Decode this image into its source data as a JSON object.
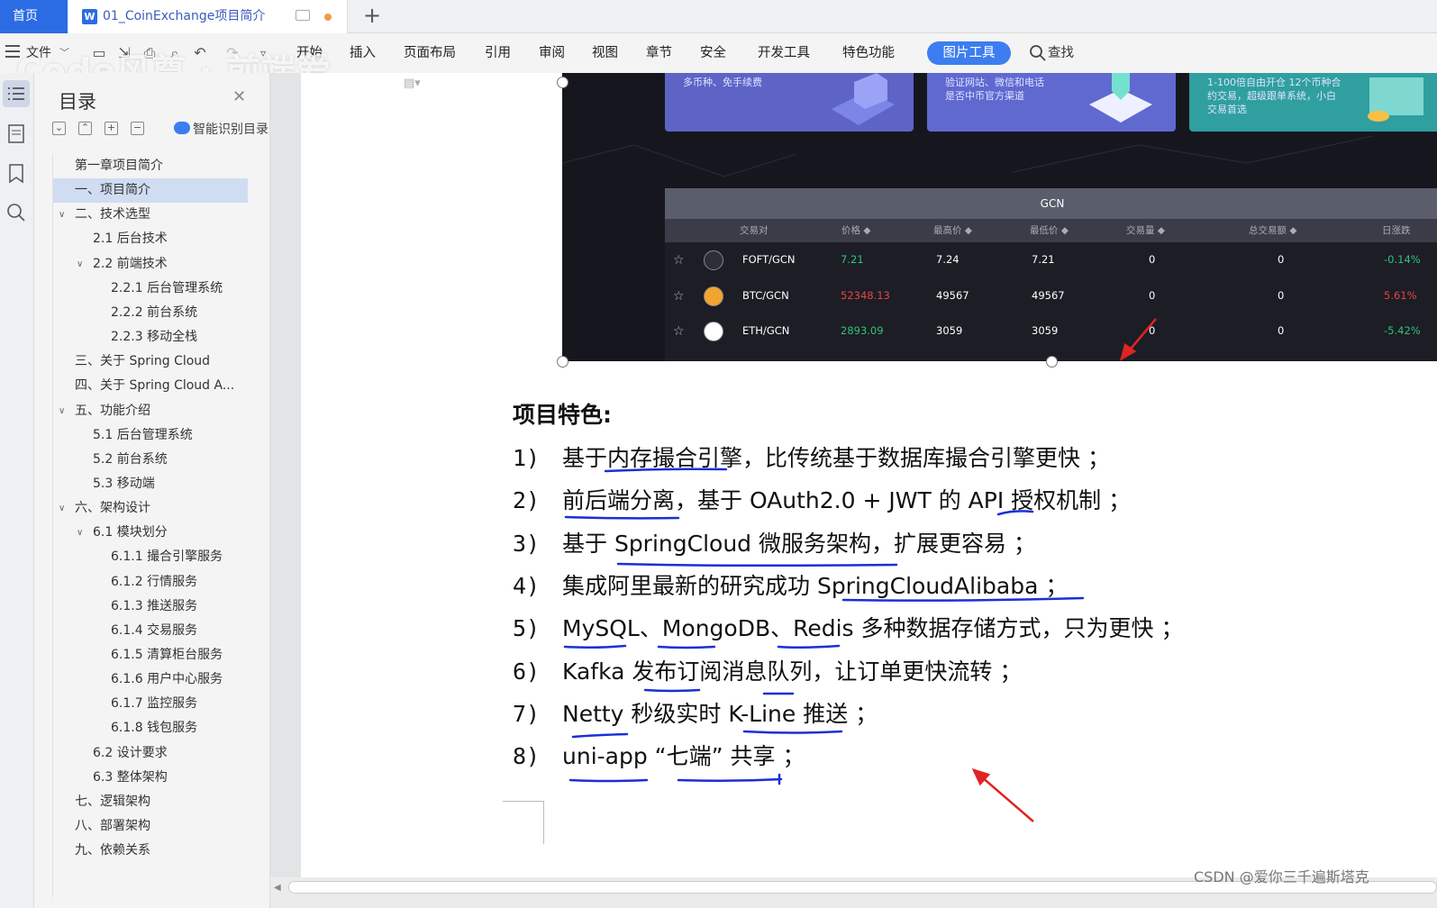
{
  "tabs": {
    "home": "首页",
    "doc_title": "01_CoinExchange项目简介"
  },
  "ribbon": {
    "file": "文件",
    "tabs": [
      "开始",
      "插入",
      "页面布局",
      "引用",
      "审阅",
      "视图",
      "章节",
      "安全",
      "开发工具",
      "特色功能"
    ],
    "active_tab": "图片工具",
    "search": "查找"
  },
  "watermark": "Code风尊 · 前端爱",
  "nav": {
    "title": "目录",
    "smart": "智能识别目录",
    "items": [
      {
        "label": "第一章项目简介",
        "level": 0
      },
      {
        "label": "一、项目简介",
        "level": 0,
        "selected": true
      },
      {
        "label": "二、技术选型",
        "level": 0,
        "expand": true
      },
      {
        "label": "2.1  后台技术",
        "level": 1
      },
      {
        "label": "2.2  前端技术",
        "level": 1,
        "expand": true
      },
      {
        "label": "2.2.1  后台管理系统",
        "level": 2
      },
      {
        "label": "2.2.2  前台系统",
        "level": 2
      },
      {
        "label": "2.2.3  移动全栈",
        "level": 2
      },
      {
        "label": "三、关于 Spring Cloud",
        "level": 0
      },
      {
        "label": "四、关于 Spring Cloud A...",
        "level": 0
      },
      {
        "label": "五、功能介绍",
        "level": 0,
        "expand": true
      },
      {
        "label": "5.1  后台管理系统",
        "level": 1
      },
      {
        "label": "5.2  前台系统",
        "level": 1
      },
      {
        "label": "5.3  移动端",
        "level": 1
      },
      {
        "label": "六、架构设计",
        "level": 0,
        "expand": true
      },
      {
        "label": "6.1  模块划分",
        "level": 1,
        "expand": true
      },
      {
        "label": "6.1.1  撮合引擎服务",
        "level": 2
      },
      {
        "label": "6.1.2  行情服务",
        "level": 2
      },
      {
        "label": "6.1.3  推送服务",
        "level": 2
      },
      {
        "label": "6.1.4  交易服务",
        "level": 2
      },
      {
        "label": "6.1.5  清算柜台服务",
        "level": 2
      },
      {
        "label": "6.1.6  用户中心服务",
        "level": 2
      },
      {
        "label": "6.1.7  监控服务",
        "level": 2
      },
      {
        "label": "6.1.8  钱包服务",
        "level": 2
      },
      {
        "label": "6.2  设计要求",
        "level": 1
      },
      {
        "label": "6.3  整体架构",
        "level": 1
      },
      {
        "label": "七、逻辑架构",
        "level": 0
      },
      {
        "label": "八、部署架构",
        "level": 0
      },
      {
        "label": "九、依赖关系",
        "level": 0
      }
    ]
  },
  "embed": {
    "cards": [
      {
        "text": "多币种、免手续费"
      },
      {
        "text": "验证网站、微信和电话\n是否中币官方渠道"
      },
      {
        "text": "1-100倍自由开仓 12个币种合\n约交易，超级跟单系统，小白\n交易首选"
      }
    ],
    "table_title": "GCN",
    "columns": [
      "交易对",
      "价格 ◆",
      "最高价 ◆",
      "最低价 ◆",
      "交易量 ◆",
      "总交易额 ◆",
      "日涨跌"
    ],
    "rows": [
      {
        "pair": "FOFT/GCN",
        "price": "7.21",
        "price_color": "green",
        "high": "7.24",
        "low": "7.21",
        "volume": "0",
        "amount": "0",
        "change": "-0.14%",
        "change_color": "green"
      },
      {
        "pair": "BTC/GCN",
        "price": "52348.13",
        "price_color": "red",
        "high": "49567",
        "low": "49567",
        "volume": "0",
        "amount": "0",
        "change": "5.61%",
        "change_color": "red"
      },
      {
        "pair": "ETH/GCN",
        "price": "2893.09",
        "price_color": "green",
        "high": "3059",
        "low": "3059",
        "volume": "0",
        "amount": "0",
        "change": "-5.42%",
        "change_color": "green"
      }
    ]
  },
  "features": {
    "title": "项目特色:",
    "items": [
      {
        "num": "1)",
        "text": "基于内存撮合引擎，比传统基于数据库撮合引擎更快 ；"
      },
      {
        "num": "2)",
        "text": "前后端分离，基于 OAuth2.0 + JWT 的 API 授权机制 ；"
      },
      {
        "num": "3)",
        "text": "基于 SpringCloud 微服务架构，扩展更容易 ；"
      },
      {
        "num": "4)",
        "text": "集成阿里最新的研究成功 SpringCloudAlibaba ；"
      },
      {
        "num": "5)",
        "text": "MySQL、MongoDB、Redis 多种数据存储方式，只为更快 ；"
      },
      {
        "num": "6)",
        "text": "Kafka 发布订阅消息队列，让订单更快流转 ；"
      },
      {
        "num": "7)",
        "text": "Netty 秒级实时 K-Line 推送  ；"
      },
      {
        "num": "8)",
        "text": "uni-app “七端” 共享 ；"
      }
    ]
  },
  "csdn_credit": "CSDN @爱你三千遍斯塔克",
  "colors": {
    "accent": "#3d7df0",
    "annotation_blue": "#1a2fd8",
    "annotation_red": "#e02424"
  }
}
